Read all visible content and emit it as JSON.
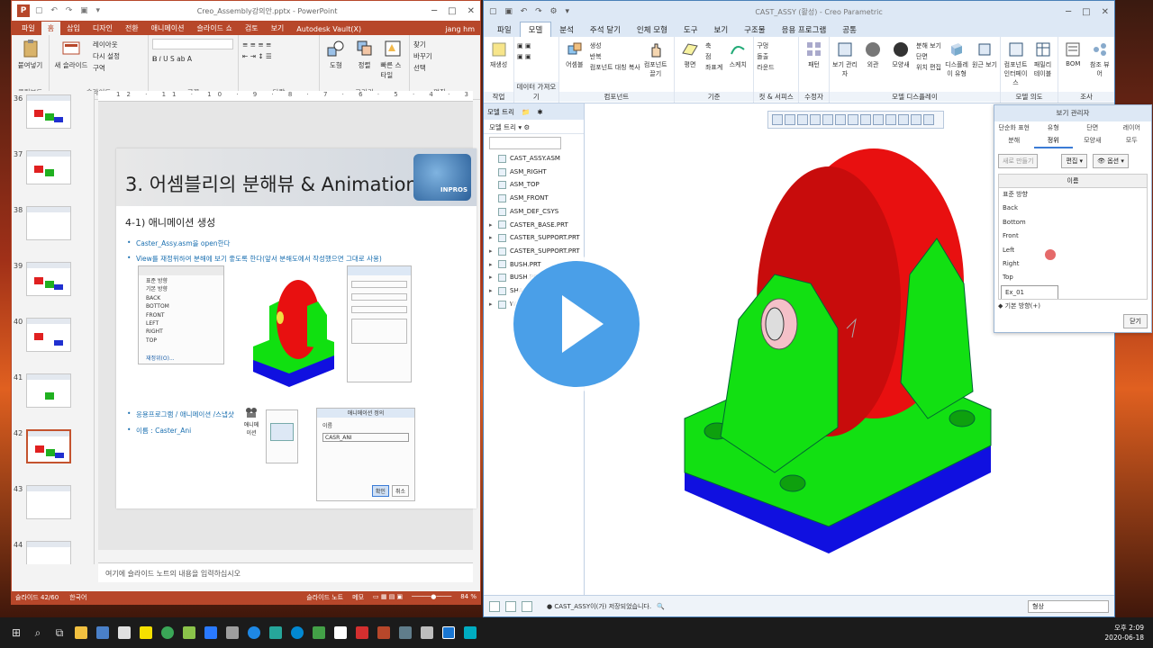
{
  "ppt": {
    "title": "Creo_Assembly강의안.pptx - PowerPoint",
    "tabs": [
      "파일",
      "홈",
      "삽입",
      "디자인",
      "전환",
      "애니메이션",
      "슬라이드 쇼",
      "검토",
      "보기",
      "Autodesk Vault(X)"
    ],
    "active_tab": "홈",
    "user": "jang hm",
    "ribbon": {
      "paste": "붙여넣기",
      "new_slide": "새 슬라이드",
      "layout": "레이아웃",
      "reset": "다시 설정",
      "section": "구역",
      "shapes": "도형",
      "arrange": "정렬",
      "quick_styles": "빠른 스타일",
      "find": "찾기",
      "replace": "바꾸기",
      "select": "선택",
      "groups": [
        "클립보드",
        "슬라이드",
        "글꼴",
        "단락",
        "그리기",
        "편집"
      ]
    },
    "ruler": "12 · 11 · 10 · 9 · 8 · 7 · 6 · 5 · 4 · 3 · 2 · 1 · 0 · 1 · 2 · 3 · 4 · 5 · 6 · 7 · 8 · 9 · 10 · 11 · 12",
    "slide_numbers": [
      "36",
      "37",
      "38",
      "39",
      "40",
      "41",
      "42",
      "43",
      "44"
    ],
    "selected_slide": "42",
    "slide": {
      "title": "3. 어셈블리의 분해뷰 & Animation",
      "logo_text": "INPROS",
      "subtitle": "4-1) 애니메이션 생성",
      "bullets": [
        "Caster_Assy.asm을 open한다",
        "View를 재정위하여 분해에 보기 좋도록 한다(앞서 분해도에서 작성했으면 그대로 사용)",
        "응용프로그램 / 애니메이션 /스냅샷",
        "이름 : Caster_Ani"
      ],
      "view_list": [
        "표준 방향",
        "기본 방향",
        "BACK",
        "BOTTOM",
        "FRONT",
        "LEFT",
        "RIGHT",
        "TOP"
      ],
      "reorient": "재정위(O)...",
      "anim_dialog_title": "애니메이션 정의",
      "anim_name_label": "이름",
      "anim_name_value": "CASR_ANI",
      "ok": "확인",
      "cancel": "취소",
      "anim_icon_label": "애니메이션"
    },
    "notes_placeholder": "여기에 슬라이드 노트의 내용을 입력하십시오",
    "status": {
      "slide_count": "슬라이드 42/60",
      "language": "한국어",
      "notes": "슬라이드 노트",
      "comments": "메모",
      "zoom": "84 %"
    }
  },
  "creo": {
    "title": "CAST_ASSY (활성) - Creo Parametric",
    "tabs": [
      "파일",
      "모델",
      "분석",
      "주석 달기",
      "인체 모형",
      "도구",
      "보기",
      "구조물",
      "응용 프로그램",
      "공통"
    ],
    "active_tab": "모델",
    "ribbon": {
      "regenerate": "재생성",
      "assemble": "어셈블",
      "create": "생성",
      "repeat": "반복",
      "component_copy": "컴포넌트 대칭 복사",
      "component_pull": "컴포넌트 끌기",
      "plane": "평면",
      "axis": "축",
      "point": "점",
      "csys": "좌표계",
      "sketch": "스케치",
      "hole": "구멍",
      "extrude": "돌출",
      "round": "라운드",
      "pattern": "패턴",
      "view_manager": "보기 관리자",
      "appearance": "외관",
      "display_style": "모양새",
      "section": "단면",
      "display_edit": "분해 보기",
      "position_edit": "위치 편집",
      "display_by_category": "디스플레이 유형",
      "origin_view": "원근 보기",
      "component_interface": "컴포넌트 인터페이스",
      "family_table": "패밀리 테이블",
      "bom": "BOM",
      "reference_viewer": "참조 뷰어",
      "groups": [
        "작업",
        "데이터 가져오기",
        "컴포넌트",
        "기준",
        "컷 & 서피스",
        "수정자",
        "모델 디스플레이",
        "모델 의도",
        "조사"
      ]
    },
    "tree_tabs": [
      "모델 트리",
      "",
      "",
      ""
    ],
    "tree_label": "모델 트리",
    "tree": [
      {
        "name": "CAST_ASSY.ASM",
        "arrow": ""
      },
      {
        "name": "ASM_RIGHT",
        "arrow": ""
      },
      {
        "name": "ASM_TOP",
        "arrow": ""
      },
      {
        "name": "ASM_FRONT",
        "arrow": ""
      },
      {
        "name": "ASM_DEF_CSYS",
        "arrow": ""
      },
      {
        "name": "CASTER_BASE.PRT",
        "arrow": "▸"
      },
      {
        "name": "CASTER_SUPPORT.PRT",
        "arrow": "▸"
      },
      {
        "name": "CASTER_SUPPORT.PRT",
        "arrow": "▸"
      },
      {
        "name": "BUSH.PRT",
        "arrow": "▸"
      },
      {
        "name": "BUSH.PRT",
        "arrow": "▸"
      },
      {
        "name": "SHA",
        "arrow": "▸"
      },
      {
        "name": "W",
        "arrow": "▸"
      }
    ],
    "status_message": "● CAST_ASSY이(가) 저장되었습니다.",
    "selection_filter": "형상"
  },
  "view_manager": {
    "title": "보기 관리자",
    "tabs_row1": [
      "단순화 표현",
      "유형",
      "단면",
      "레이어"
    ],
    "tabs_row2": [
      "분해",
      "정위",
      "모양새",
      "모두"
    ],
    "active_tab": "정위",
    "new_button": "새로 만들기",
    "edit_button": "편집",
    "options_button": "옵션",
    "column_header": "이름",
    "items": [
      "표준 방향",
      "Back",
      "Bottom",
      "Front",
      "Left",
      "Right",
      "Top"
    ],
    "editing_value": "Ex_01",
    "footer": "◆ 기본 방향(+)",
    "close": "닫기"
  },
  "taskbar": {
    "time": "오후 2:09",
    "date": "2020-06-18"
  },
  "colors": {
    "ppt_accent": "#b7472a",
    "creo_accent": "#dde8f5",
    "part_red": "#e81010",
    "part_green": "#10e010",
    "part_blue": "#1010e0",
    "play_button": "#4a9fe8"
  }
}
